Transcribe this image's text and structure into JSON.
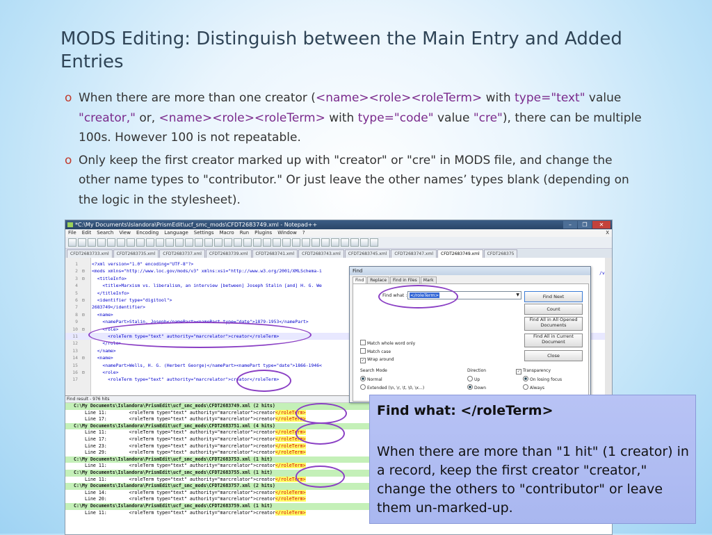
{
  "slide": {
    "title": "MODS Editing: Distinguish between the Main Entry and Added Entries",
    "bullet1": {
      "t1": "When there are more than one creator (",
      "tag1": "<name><role><roleTerm>",
      "t2": " with ",
      "type1": "type=\"text\"",
      "t3": "  value ",
      "val1": "\"creator,\"",
      "t4": " or, ",
      "tag2": "<name><role><roleTerm>",
      "t5": " with ",
      "type2": "type=\"code\"",
      "t6": " value ",
      "val2": "\"cre\"",
      "t7": "), there can be multiple 100s. However 100 is not repeatable."
    },
    "bullet2": "Only keep the first creator marked up with \"creator\" or \"cre\" in MODS file, and change the other name types to \"contributor.\" Or just leave the other names’ types blank (depending on the logic in the stylesheet).",
    "bullet_marker": "o"
  },
  "window": {
    "title": "*C:\\My Documents\\Islandora\\PrismEdit\\ucf_smc_mods\\CFDT2683749.xml - Notepad++",
    "buttons": {
      "min": "–",
      "max": "❐",
      "close": "✕"
    },
    "menu": [
      "File",
      "Edit",
      "Search",
      "View",
      "Encoding",
      "Language",
      "Settings",
      "Macro",
      "Run",
      "Plugins",
      "Window",
      "?"
    ],
    "menu_close": "X",
    "tabs": [
      "CFDT2683733.xml",
      "CFDT2683735.xml",
      "CFDT2683737.xml",
      "CFDT2683739.xml",
      "CFDT2683741.xml",
      "CFDT2683743.xml",
      "CFDT2683745.xml",
      "CFDT2683747.xml",
      "CFDT2683749.xml",
      "CFDT268375"
    ],
    "active_tab": 8,
    "code": [
      {
        "n": "1",
        "f": "",
        "t": "<?xml version=\"1.0\" encoding=\"UTF-8\"?>"
      },
      {
        "n": "2",
        "f": "⊟",
        "t": "<mods xmlns=\"http://www.loc.gov/mods/v3\" xmlns:xsi=\"http://www.w3.org/2001/XMLSchema-i"
      },
      {
        "n": "3",
        "f": "⊟",
        "t": "  <titleInfo>"
      },
      {
        "n": "4",
        "f": "",
        "t": "    <title>Marxism vs. liberalism, an interview [between] Joseph Stalin [and] H. G. We"
      },
      {
        "n": "5",
        "f": "",
        "t": "  </titleInfo>"
      },
      {
        "n": "6",
        "f": "⊟",
        "t": "  <identifier type=\"digitool\">"
      },
      {
        "n": "7",
        "f": "",
        "t": "2683749</identifier>"
      },
      {
        "n": "8",
        "f": "⊟",
        "t": "  <name>"
      },
      {
        "n": "9",
        "f": "",
        "t": "    <namePart>Stalin, Joseph</namePart><namePart type=\"date\">1879-1953</namePart>"
      },
      {
        "n": "10",
        "f": "⊟",
        "t": "    <role>"
      },
      {
        "n": "11",
        "f": "",
        "t": "      <roleTerm type=\"text\" authority=\"marcrelator\">creator</roleTerm>"
      },
      {
        "n": "12",
        "f": "",
        "t": "    </role>"
      },
      {
        "n": "13",
        "f": "",
        "t": "  </name>"
      },
      {
        "n": "14",
        "f": "⊟",
        "t": "  <name>"
      },
      {
        "n": "15",
        "f": "",
        "t": "    <namePart>Wells, H. G. (Herbert George)</namePart><namePart type=\"date\">1866-1946<"
      },
      {
        "n": "16",
        "f": "⊟",
        "t": "    <role>"
      },
      {
        "n": "17",
        "f": "",
        "t": "      <roleTerm type=\"text\" authority=\"marcrelator\">creator</roleTerm>"
      }
    ],
    "code_right": "/v1",
    "scroll_mark": "\"\"\""
  },
  "find": {
    "title": "Find",
    "tabs": [
      "Find",
      "Replace",
      "Find in Files",
      "Mark"
    ],
    "find_what_label": "Find what :",
    "find_what_value": "</roleTerm>",
    "buttons": [
      "Find Next",
      "Count",
      "Find All in All Opened Documents",
      "Find All in Current Document",
      "Close"
    ],
    "options": [
      "Match whole word only",
      "Match case",
      "Wrap around"
    ],
    "search_mode_label": "Search Mode",
    "modes": [
      "Normal",
      "Extended (\\n, \\r, \\t, \\0, \\x...)"
    ],
    "direction_label": "Direction",
    "directions": [
      "Up",
      "Down"
    ],
    "transparency_label": "Transparency",
    "transparency": [
      "On losing focus",
      "Always"
    ]
  },
  "results": {
    "header": "Find result - 976 hits",
    "lines": [
      {
        "file": true,
        "text": "C:\\My Documents\\Islandora\\PrismEdit\\ucf_smc_mods\\CFDT2683749.xml (2 hits)"
      },
      {
        "file": false,
        "pre": "Line 11:        <roleTerm type=\"text\" authority=\"marcrelator\">creator",
        "hit": "</roleTerm>"
      },
      {
        "file": false,
        "pre": "Line 17:        <roleTerm type=\"text\" authority=\"marcrelator\">creator",
        "hit": "</roleTerm>"
      },
      {
        "file": true,
        "text": "C:\\My Documents\\Islandora\\PrismEdit\\ucf_smc_mods\\CFDT2683751.xml (4 hits)"
      },
      {
        "file": false,
        "pre": "Line 11:        <roleTerm type=\"text\" authority=\"marcrelator\">creator",
        "hit": "</roleTerm>"
      },
      {
        "file": false,
        "pre": "Line 17:        <roleTerm type=\"text\" authority=\"marcrelator\">creator",
        "hit": "</roleTerm>"
      },
      {
        "file": false,
        "pre": "Line 23:        <roleTerm type=\"text\" authority=\"marcrelator\">creator",
        "hit": "</roleTerm>"
      },
      {
        "file": false,
        "pre": "Line 29:        <roleTerm type=\"text\" authority=\"marcrelator\">creator",
        "hit": "</roleTerm>"
      },
      {
        "file": true,
        "text": "C:\\My Documents\\Islandora\\PrismEdit\\ucf_smc_mods\\CFDT2683753.xml (1 hit)"
      },
      {
        "file": false,
        "pre": "Line 11:        <roleTerm type=\"text\" authority=\"marcrelator\">creator",
        "hit": "</roleTerm>"
      },
      {
        "file": true,
        "text": "C:\\My Documents\\Islandora\\PrismEdit\\ucf_smc_mods\\CFDT2683755.xml (1 hit)"
      },
      {
        "file": false,
        "pre": "Line 11:        <roleTerm type=\"text\" authority=\"marcrelator\">creator",
        "hit": "</roleTerm>"
      },
      {
        "file": true,
        "text": "C:\\My Documents\\Islandora\\PrismEdit\\ucf_smc_mods\\CFDT2683757.xml (2 hits)"
      },
      {
        "file": false,
        "pre": "Line 14:        <roleTerm type=\"text\" authority=\"marcrelator\">creator",
        "hit": "</roleTerm>"
      },
      {
        "file": false,
        "pre": "Line 20:        <roleTerm type=\"text\" authority=\"marcrelator\">creator",
        "hit": "</roleTerm>"
      },
      {
        "file": true,
        "text": "C:\\My Documents\\Islandora\\PrismEdit\\ucf_smc_mods\\CFDT2683759.xml (1 hit)"
      },
      {
        "file": false,
        "pre": "Line 11:        <roleTerm type=\"text\" authority=\"marcrelator\">creator",
        "hit": "</roleTerm>"
      }
    ]
  },
  "callout": {
    "title": "Find what: </roleTerm>",
    "body": "When there are more than \"1 hit\" (1 creator) in a record, keep the first creator \"creator,\" change the others to \"contributor\" or leave them un-marked-up."
  },
  "colors": {
    "annotation": "#8a3fc4",
    "hit_fg": "#d40000",
    "file_row": "#c4f0b8",
    "callout": "#b8c3f5"
  }
}
